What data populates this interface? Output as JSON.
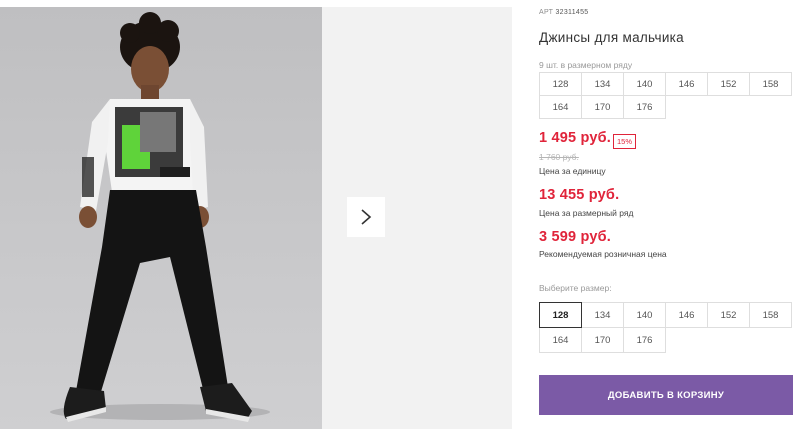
{
  "product": {
    "art_label": "АРТ",
    "art_number": "32311455",
    "title": "Джинсы для мальчика"
  },
  "size_range": {
    "label": "9 шт. в размерном ряду",
    "rows": [
      [
        "128",
        "134",
        "140",
        "146",
        "152",
        "158"
      ],
      [
        "164",
        "170",
        "176"
      ]
    ]
  },
  "prices": {
    "unit_price": "1 495 руб.",
    "discount": "15%",
    "old_price": "1 760 руб.",
    "unit_label": "Цена за единицу",
    "range_price": "13 455 руб.",
    "range_label": "Цена за размерный ряд",
    "retail_price": "3 599 руб.",
    "retail_label": "Рекомендуемая розничная цена"
  },
  "size_picker": {
    "label": "Выберите размер:",
    "selected": "128",
    "rows": [
      [
        "128",
        "134",
        "140",
        "146",
        "152",
        "158"
      ],
      [
        "164",
        "170",
        "176"
      ]
    ]
  },
  "cart": {
    "button_label": "ДОБАВИТЬ В КОРЗИНУ"
  },
  "colors": {
    "accent": "#7b5aa6",
    "price_red": "#e0243a"
  },
  "icons": {
    "next": "chevron-right-icon"
  }
}
